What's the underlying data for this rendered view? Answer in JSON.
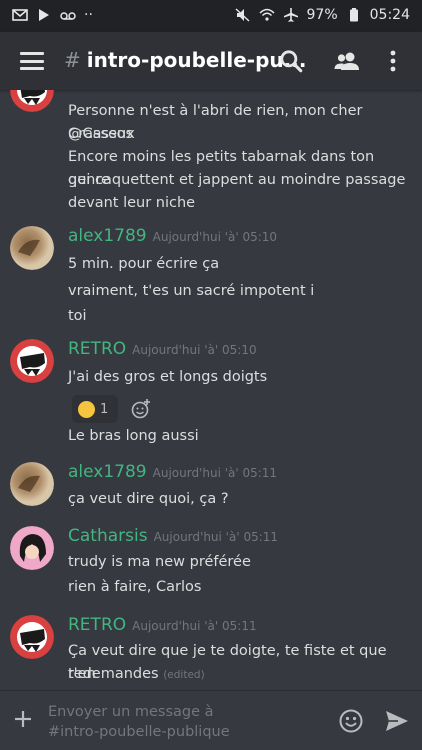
{
  "status_bar": {
    "battery": "97%",
    "time": "05:24",
    "dots": "··"
  },
  "header": {
    "channel_hash": "#",
    "channel_name": "intro-poubelle-pu..."
  },
  "messages": {
    "partial": {
      "lines": [
        "Personne n'est à l'abri de rien, mon cher @Cassos",
        "Crasseux",
        "Encore moins les petits tabarnak dans ton genre",
        "qui caquettent et jappent au moindre passage",
        "devant leur niche"
      ]
    },
    "g1": {
      "author": "alex1789",
      "timestamp": "Aujourd'hui 'à' 05:10",
      "lines": [
        "5 min. pour écrire ça",
        "vraiment, t'es un sacré impotent i",
        "toi"
      ]
    },
    "g2": {
      "author": "RETRO",
      "timestamp": "Aujourd'hui 'à' 05:10",
      "line1": "J'ai des gros et longs doigts",
      "reaction_count": "1",
      "line2": "Le bras long aussi"
    },
    "g3": {
      "author": "alex1789",
      "timestamp": "Aujourd'hui 'à' 05:11",
      "line1": "ça veut dire quoi, ça ?"
    },
    "g4": {
      "author": "Catharsis",
      "timestamp": "Aujourd'hui 'à' 05:11",
      "line1": "trudy is ma new préférée",
      "line2": "rien à faire, Carlos"
    },
    "g5": {
      "author": "RETRO",
      "timestamp": "Aujourd'hui 'à' 05:11",
      "line1": "Ça veut dire que je te doigte, te fiste et que t'en",
      "line2": "redemandes",
      "edited": "(edited)"
    }
  },
  "composer": {
    "placeholder_line1": "Envoyer un message à",
    "placeholder_line2": "#intro-poubelle-publique"
  },
  "colors": {
    "author_green": "#43b581",
    "background": "#36393f",
    "header": "#2f3136",
    "statusbar": "#202225"
  }
}
